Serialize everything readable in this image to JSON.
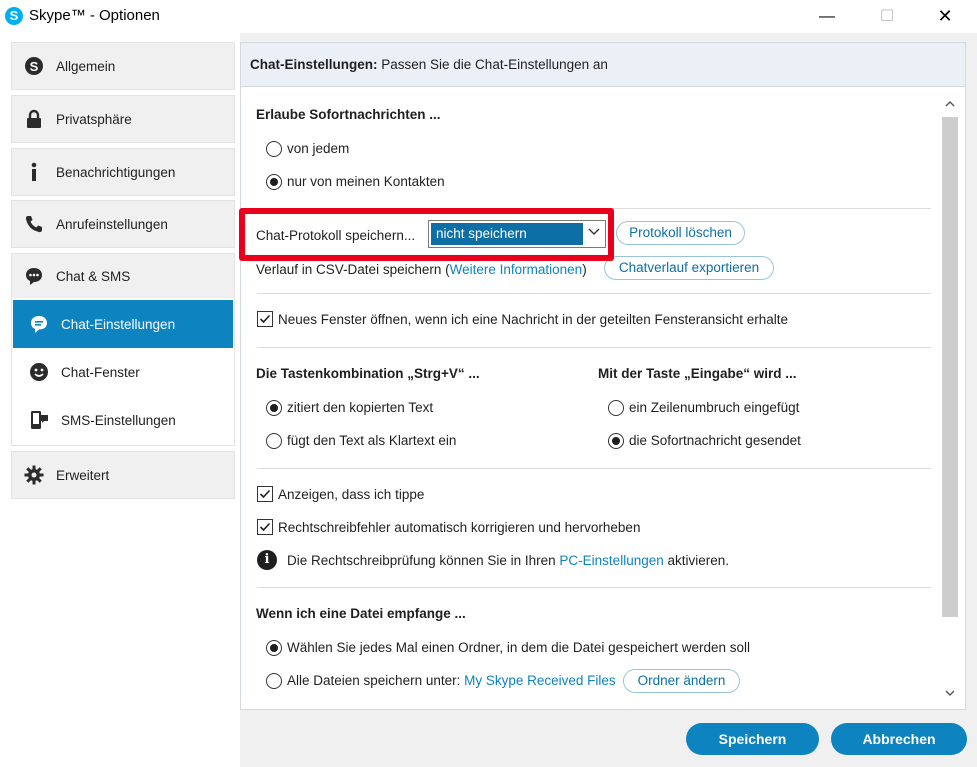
{
  "window": {
    "title": "Skype™ - Optionen",
    "minimize": "—",
    "maximize": "☐",
    "close": "✕"
  },
  "sidebar": {
    "items": [
      {
        "label": "Allgemein",
        "icon": "skype-icon"
      },
      {
        "label": "Privatsphäre",
        "icon": "lock-icon"
      },
      {
        "label": "Benachrichtigungen",
        "icon": "info-icon"
      },
      {
        "label": "Anrufeinstellungen",
        "icon": "phone-icon"
      }
    ],
    "group": {
      "label": "Chat & SMS",
      "icon": "chat-icon",
      "subitems": [
        {
          "label": "Chat-Einstellungen",
          "icon": "chat-bubble-icon",
          "active": true
        },
        {
          "label": "Chat-Fenster",
          "icon": "smiley-icon",
          "active": false
        },
        {
          "label": "SMS-Einstellungen",
          "icon": "sms-icon",
          "active": false
        }
      ]
    },
    "advanced": {
      "label": "Erweitert",
      "icon": "gear-icon"
    }
  },
  "header": {
    "title_bold": "Chat-Einstellungen:",
    "title_rest": " Passen Sie die Chat-Einstellungen an"
  },
  "instant_messages": {
    "heading": "Erlaube Sofortnachrichten ...",
    "option_everyone": "von jedem",
    "option_contacts": "nur von meinen Kontakten",
    "selected": "nur von meinen Kontakten"
  },
  "history": {
    "label": "Chat-Protokoll speichern...",
    "select_value": "nicht speichern",
    "delete_button": "Protokoll löschen",
    "csv_label": "Verlauf in CSV-Datei speichern (",
    "csv_link": "Weitere Informationen",
    "csv_close": ")",
    "export_button": "Chatverlauf exportieren"
  },
  "new_window": {
    "label": "Neues Fenster öffnen, wenn ich eine Nachricht in der geteilten Fensteransicht erhalte",
    "checked": true
  },
  "paste": {
    "heading": "Die Tastenkombination „Strg+V“ ...",
    "option_quote": "zitiert den kopierten Text",
    "option_plain": "fügt den Text als Klartext ein",
    "selected": "zitiert den kopierten Text"
  },
  "enter": {
    "heading": "Mit der Taste „Eingabe“ wird ...",
    "option_newline": "ein Zeilenumbruch eingefügt",
    "option_send": "die Sofortnachricht gesendet",
    "selected": "die Sofortnachricht gesendet"
  },
  "typing": {
    "label": "Anzeigen, dass ich tippe",
    "checked": true
  },
  "spelling": {
    "label": "Rechtschreibfehler automatisch korrigieren und hervorheben",
    "checked": true
  },
  "spell_info": {
    "text_before": "Die Rechtschreibprüfung können Sie in Ihren ",
    "link": "PC-Einstellungen",
    "text_after": " aktivieren."
  },
  "files": {
    "heading": "Wenn ich eine Datei empfange ...",
    "option_ask": "Wählen Sie jedes Mal einen Ordner, in dem die Datei gespeichert werden soll",
    "option_all": "Alle Dateien speichern unter: ",
    "folder_link": "My Skype Received Files",
    "change_button": "Ordner ändern",
    "selected": "Wählen Sie jedes Mal einen Ordner, in dem die Datei gespeichert werden soll"
  },
  "footer": {
    "save": "Speichern",
    "cancel": "Abbrechen"
  },
  "colors": {
    "accent": "#0d83c0",
    "highlight_frame": "#e8001d",
    "link": "#0d83c0"
  }
}
